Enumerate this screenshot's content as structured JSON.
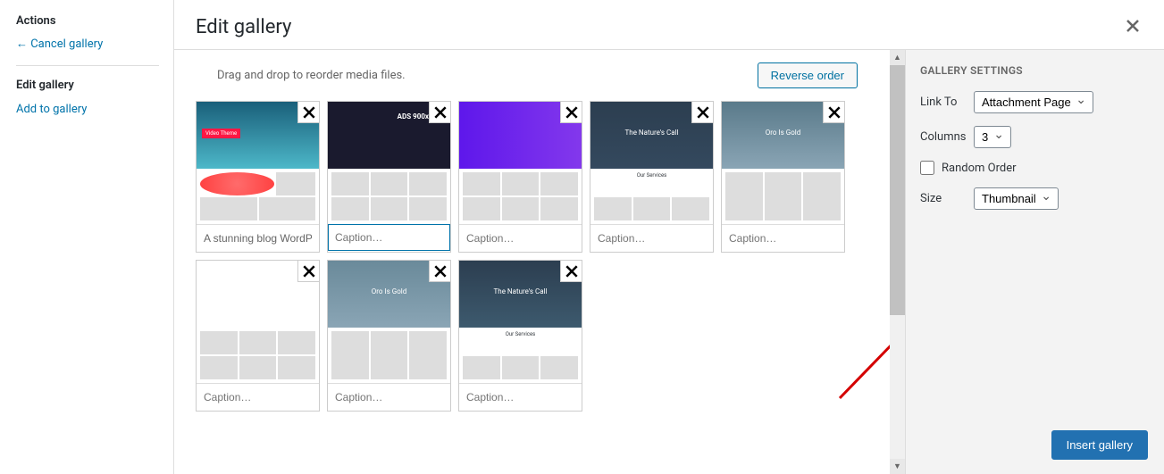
{
  "sidebar": {
    "actions_heading": "Actions",
    "cancel_label": "← Cancel gallery",
    "edit_label": "Edit gallery",
    "add_label": "Add to gallery"
  },
  "header": {
    "title": "Edit gallery"
  },
  "toolbar": {
    "hint": "Drag and drop to reorder media files.",
    "reverse_label": "Reverse order"
  },
  "gallery": {
    "caption_placeholder": "Caption…",
    "items": [
      {
        "caption": "A stunning blog WordP"
      },
      {
        "caption": ""
      },
      {
        "caption": ""
      },
      {
        "caption": ""
      },
      {
        "caption": ""
      },
      {
        "caption": ""
      },
      {
        "caption": ""
      },
      {
        "caption": ""
      }
    ],
    "selected_index": 1
  },
  "settings": {
    "heading": "GALLERY SETTINGS",
    "link_to_label": "Link To",
    "link_to_value": "Attachment Page",
    "columns_label": "Columns",
    "columns_value": "3",
    "random_label": "Random Order",
    "size_label": "Size",
    "size_value": "Thumbnail"
  },
  "footer": {
    "insert_label": "Insert gallery"
  },
  "annotation": {
    "color": "#d40000"
  },
  "thumb_texts": {
    "badge1": "Video Theme",
    "ads": "ADS 900x",
    "nature": "The Nature's Call",
    "oro": "Oro Is Gold",
    "services": "Our Services"
  }
}
